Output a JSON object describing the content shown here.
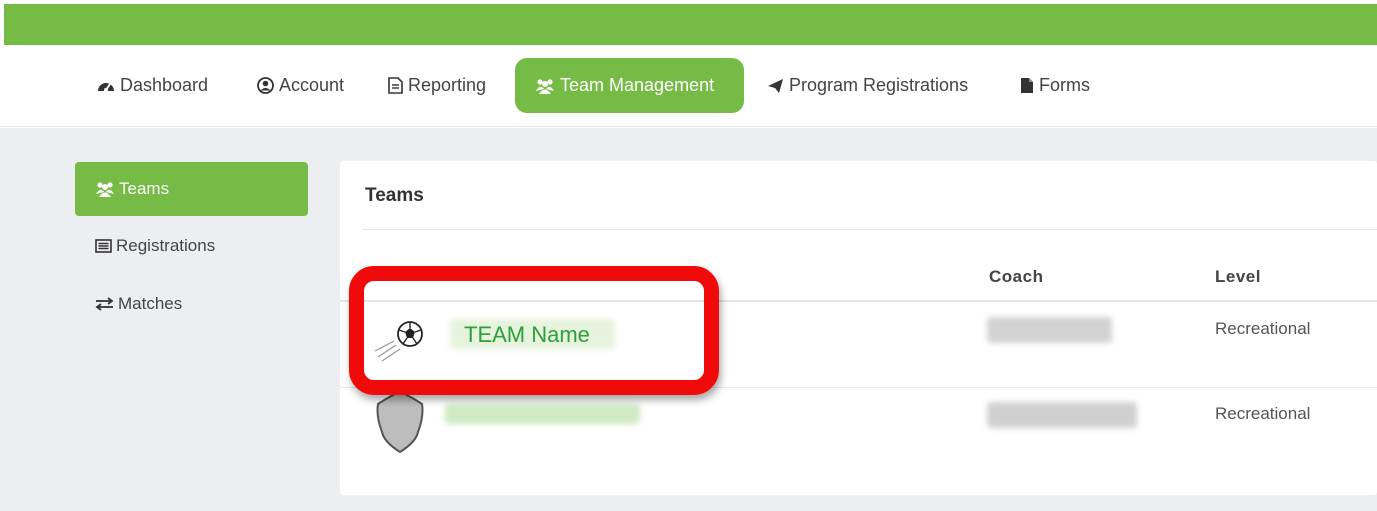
{
  "nav": {
    "items": [
      {
        "label": "Dashboard",
        "icon": "dashboard-icon"
      },
      {
        "label": "Account",
        "icon": "user-circle-icon"
      },
      {
        "label": "Reporting",
        "icon": "file-text-icon"
      },
      {
        "label": "Team Management",
        "icon": "users-icon",
        "active": true
      },
      {
        "label": "Program Registrations",
        "icon": "paper-plane-icon"
      },
      {
        "label": "Forms",
        "icon": "file-icon"
      }
    ]
  },
  "sidebar": {
    "items": [
      {
        "label": "Teams",
        "icon": "users-icon",
        "active": true
      },
      {
        "label": "Registrations",
        "icon": "list-icon"
      },
      {
        "label": "Matches",
        "icon": "exchange-icon"
      }
    ]
  },
  "panel": {
    "title": "Teams",
    "columns": [
      "Coach",
      "Level"
    ],
    "rows": [
      {
        "team": "TEAM Name",
        "logo": "soccer-ball-icon",
        "level": "Recreational"
      },
      {
        "team": "",
        "logo": "shield-icon",
        "level": "Recreational"
      }
    ]
  },
  "colors": {
    "brand_green": "#76bb45",
    "link_green": "#2e9e3a",
    "highlight_red": "#f00a0a"
  }
}
